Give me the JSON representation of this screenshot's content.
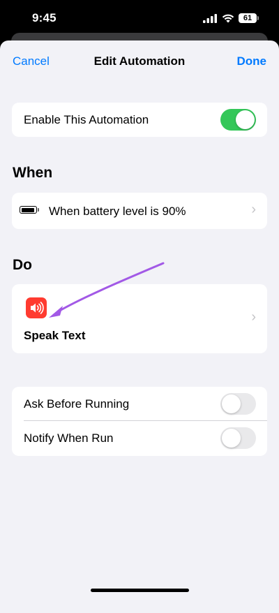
{
  "status_bar": {
    "time": "9:45",
    "battery": "61",
    "icons": [
      "signal-icon",
      "wifi-icon",
      "battery-icon"
    ]
  },
  "nav": {
    "cancel": "Cancel",
    "title": "Edit Automation",
    "done": "Done"
  },
  "enable": {
    "label": "Enable This Automation",
    "on": true
  },
  "when": {
    "header": "When",
    "trigger": "When battery level is 90%",
    "icon": "battery-icon"
  },
  "do": {
    "header": "Do",
    "action": "Speak Text",
    "icon": "speaker-icon",
    "icon_color": "#ff3b30"
  },
  "options": {
    "ask_before_running": {
      "label": "Ask Before Running",
      "on": false
    },
    "notify_when_run": {
      "label": "Notify When Run",
      "on": false
    }
  },
  "colors": {
    "accent": "#007aff",
    "toggle_on": "#34c759",
    "annotation_arrow": "#a259e6"
  }
}
